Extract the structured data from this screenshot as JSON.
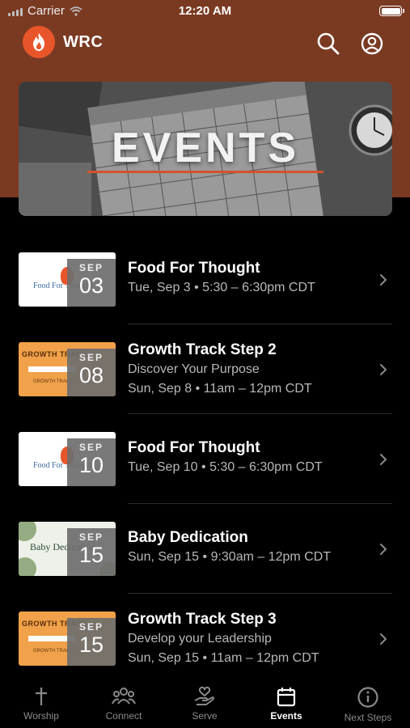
{
  "status": {
    "carrier": "Carrier",
    "time": "12:20 AM"
  },
  "app": {
    "title": "WRC"
  },
  "banner": {
    "title": "EVENTS"
  },
  "events": [
    {
      "month": "SEP",
      "day": "03",
      "title": "Food For Thought",
      "lines": [
        "Tue, Sep 3 • 5:30 – 6:30pm CDT"
      ],
      "thumb": "Food For Thought"
    },
    {
      "month": "SEP",
      "day": "08",
      "title": "Growth Track Step 2",
      "lines": [
        "Discover Your Purpose",
        "Sun, Sep 8 • 11am – 12pm CDT"
      ],
      "thumb": "GROWTH TRACK"
    },
    {
      "month": "SEP",
      "day": "10",
      "title": "Food For Thought",
      "lines": [
        "Tue, Sep 10 • 5:30 – 6:30pm CDT"
      ],
      "thumb": "Food For Thought"
    },
    {
      "month": "SEP",
      "day": "15",
      "title": "Baby Dedication",
      "lines": [
        "Sun, Sep 15 • 9:30am – 12pm CDT"
      ],
      "thumb": "Baby Dedication"
    },
    {
      "month": "SEP",
      "day": "15",
      "title": "Growth Track Step 3",
      "lines": [
        "Develop your Leadership",
        "Sun, Sep 15 • 11am – 12pm CDT"
      ],
      "thumb": "GROWTH TRACK"
    }
  ],
  "tabs": [
    {
      "label": "Worship",
      "icon": "cross-icon",
      "active": false
    },
    {
      "label": "Connect",
      "icon": "people-icon",
      "active": false
    },
    {
      "label": "Serve",
      "icon": "hand-heart-icon",
      "active": false
    },
    {
      "label": "Events",
      "icon": "calendar-icon",
      "active": true
    },
    {
      "label": "Next Steps",
      "icon": "info-icon",
      "active": false
    }
  ],
  "colors": {
    "header": "#7a3a22",
    "accent": "#e8552a",
    "background": "#000000"
  }
}
